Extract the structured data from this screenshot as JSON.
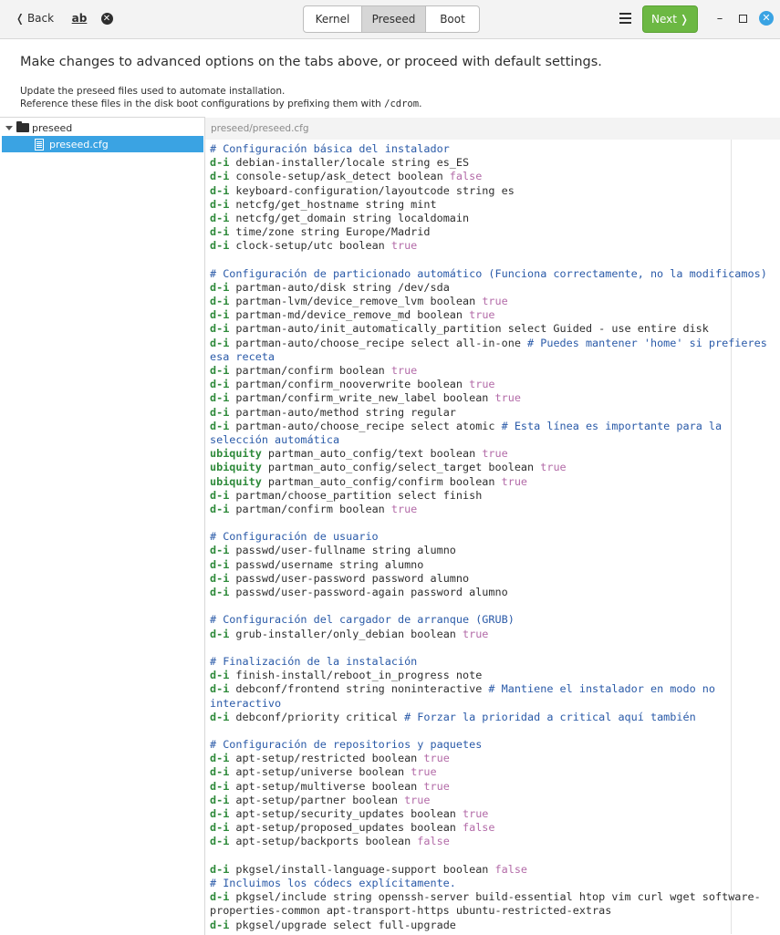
{
  "header": {
    "back_label": "Back",
    "spell_icon_text": "ab",
    "tabs": [
      "Kernel",
      "Preseed",
      "Boot"
    ],
    "active_tab": "Preseed",
    "next_label": "Next",
    "minimize_glyph": "–"
  },
  "content": {
    "heading": "Make changes to advanced options on the tabs above, or proceed with default settings.",
    "description_line1": "Update the preseed files used to automate installation.",
    "description_line2_prefix": "Reference these files in the disk boot configurations by prefixing them with ",
    "description_line2_code": "/cdrom",
    "description_line2_suffix": "."
  },
  "tree": {
    "folder_label": "preseed",
    "file_label": "preseed.cfg"
  },
  "editor": {
    "path": "preseed/preseed.cfg",
    "lines": [
      [
        [
          "cm",
          "# Configuración básica del instalador"
        ]
      ],
      [
        [
          "kw",
          "d-i"
        ],
        [
          "t",
          " debian-installer/locale string es_ES"
        ]
      ],
      [
        [
          "kw",
          "d-i"
        ],
        [
          "t",
          " console-setup/ask_detect boolean "
        ],
        [
          "bl",
          "false"
        ]
      ],
      [
        [
          "kw",
          "d-i"
        ],
        [
          "t",
          " keyboard-configuration/layoutcode string es"
        ]
      ],
      [
        [
          "kw",
          "d-i"
        ],
        [
          "t",
          " netcfg/get_hostname string mint"
        ]
      ],
      [
        [
          "kw",
          "d-i"
        ],
        [
          "t",
          " netcfg/get_domain string localdomain"
        ]
      ],
      [
        [
          "kw",
          "d-i"
        ],
        [
          "t",
          " time/zone string Europe/Madrid"
        ]
      ],
      [
        [
          "kw",
          "d-i"
        ],
        [
          "t",
          " clock-setup/utc boolean "
        ],
        [
          "bl",
          "true"
        ]
      ],
      [],
      [
        [
          "cm",
          "# Configuración de particionado automático (Funciona correctamente, no la modificamos)"
        ]
      ],
      [
        [
          "kw",
          "d-i"
        ],
        [
          "t",
          " partman-auto/disk string /dev/sda"
        ]
      ],
      [
        [
          "kw",
          "d-i"
        ],
        [
          "t",
          " partman-lvm/device_remove_lvm boolean "
        ],
        [
          "bl",
          "true"
        ]
      ],
      [
        [
          "kw",
          "d-i"
        ],
        [
          "t",
          " partman-md/device_remove_md boolean "
        ],
        [
          "bl",
          "true"
        ]
      ],
      [
        [
          "kw",
          "d-i"
        ],
        [
          "t",
          " partman-auto/init_automatically_partition select Guided - use entire disk"
        ]
      ],
      [
        [
          "kw",
          "d-i"
        ],
        [
          "t",
          " partman-auto/choose_recipe select all-in-one "
        ],
        [
          "cm",
          "# Puedes mantener 'home' si prefieres"
        ]
      ],
      [
        [
          "cm",
          "esa receta"
        ]
      ],
      [
        [
          "kw",
          "d-i"
        ],
        [
          "t",
          " partman/confirm boolean "
        ],
        [
          "bl",
          "true"
        ]
      ],
      [
        [
          "kw",
          "d-i"
        ],
        [
          "t",
          " partman/confirm_nooverwrite boolean "
        ],
        [
          "bl",
          "true"
        ]
      ],
      [
        [
          "kw",
          "d-i"
        ],
        [
          "t",
          " partman/confirm_write_new_label boolean "
        ],
        [
          "bl",
          "true"
        ]
      ],
      [
        [
          "kw",
          "d-i"
        ],
        [
          "t",
          " partman-auto/method string regular"
        ]
      ],
      [
        [
          "kw",
          "d-i"
        ],
        [
          "t",
          " partman-auto/choose_recipe select atomic "
        ],
        [
          "cm",
          "# Esta línea es importante para la"
        ]
      ],
      [
        [
          "cm",
          "selección automática"
        ]
      ],
      [
        [
          "kw",
          "ubiquity"
        ],
        [
          "t",
          " partman_auto_config/text boolean "
        ],
        [
          "bl",
          "true"
        ]
      ],
      [
        [
          "kw",
          "ubiquity"
        ],
        [
          "t",
          " partman_auto_config/select_target boolean "
        ],
        [
          "bl",
          "true"
        ]
      ],
      [
        [
          "kw",
          "ubiquity"
        ],
        [
          "t",
          " partman_auto_config/confirm boolean "
        ],
        [
          "bl",
          "true"
        ]
      ],
      [
        [
          "kw",
          "d-i"
        ],
        [
          "t",
          " partman/choose_partition select finish"
        ]
      ],
      [
        [
          "kw",
          "d-i"
        ],
        [
          "t",
          " partman/confirm boolean "
        ],
        [
          "bl",
          "true"
        ]
      ],
      [],
      [
        [
          "cm",
          "# Configuración de usuario"
        ]
      ],
      [
        [
          "kw",
          "d-i"
        ],
        [
          "t",
          " passwd/user-fullname string alumno"
        ]
      ],
      [
        [
          "kw",
          "d-i"
        ],
        [
          "t",
          " passwd/username string alumno"
        ]
      ],
      [
        [
          "kw",
          "d-i"
        ],
        [
          "t",
          " passwd/user-password password alumno"
        ]
      ],
      [
        [
          "kw",
          "d-i"
        ],
        [
          "t",
          " passwd/user-password-again password alumno"
        ]
      ],
      [],
      [
        [
          "cm",
          "# Configuración del cargador de arranque (GRUB)"
        ]
      ],
      [
        [
          "kw",
          "d-i"
        ],
        [
          "t",
          " grub-installer/only_debian boolean "
        ],
        [
          "bl",
          "true"
        ]
      ],
      [],
      [
        [
          "cm",
          "# Finalización de la instalación"
        ]
      ],
      [
        [
          "kw",
          "d-i"
        ],
        [
          "t",
          " finish-install/reboot_in_progress note"
        ]
      ],
      [
        [
          "kw",
          "d-i"
        ],
        [
          "t",
          " debconf/frontend string noninteractive "
        ],
        [
          "cm",
          "# Mantiene el instalador en modo no"
        ]
      ],
      [
        [
          "cm",
          "interactivo"
        ]
      ],
      [
        [
          "kw",
          "d-i"
        ],
        [
          "t",
          " debconf/priority critical "
        ],
        [
          "cm",
          "# Forzar la prioridad a critical aquí también"
        ]
      ],
      [],
      [
        [
          "cm",
          "# Configuración de repositorios y paquetes"
        ]
      ],
      [
        [
          "kw",
          "d-i"
        ],
        [
          "t",
          " apt-setup/restricted boolean "
        ],
        [
          "bl",
          "true"
        ]
      ],
      [
        [
          "kw",
          "d-i"
        ],
        [
          "t",
          " apt-setup/universe boolean "
        ],
        [
          "bl",
          "true"
        ]
      ],
      [
        [
          "kw",
          "d-i"
        ],
        [
          "t",
          " apt-setup/multiverse boolean "
        ],
        [
          "bl",
          "true"
        ]
      ],
      [
        [
          "kw",
          "d-i"
        ],
        [
          "t",
          " apt-setup/partner boolean "
        ],
        [
          "bl",
          "true"
        ]
      ],
      [
        [
          "kw",
          "d-i"
        ],
        [
          "t",
          " apt-setup/security_updates boolean "
        ],
        [
          "bl",
          "true"
        ]
      ],
      [
        [
          "kw",
          "d-i"
        ],
        [
          "t",
          " apt-setup/proposed_updates boolean "
        ],
        [
          "bl",
          "false"
        ]
      ],
      [
        [
          "kw",
          "d-i"
        ],
        [
          "t",
          " apt-setup/backports boolean "
        ],
        [
          "bl",
          "false"
        ]
      ],
      [],
      [
        [
          "kw",
          "d-i"
        ],
        [
          "t",
          " pkgsel/install-language-support boolean "
        ],
        [
          "bl",
          "false"
        ]
      ],
      [
        [
          "cm",
          "# Incluimos los códecs explícitamente."
        ]
      ],
      [
        [
          "kw",
          "d-i"
        ],
        [
          "t",
          " pkgsel/include string openssh-server build-essential htop vim curl wget software-"
        ]
      ],
      [
        [
          "t",
          "properties-common apt-transport-https ubuntu-restricted-extras"
        ]
      ],
      [
        [
          "kw",
          "d-i"
        ],
        [
          "t",
          " pkgsel/upgrade select full-upgrade"
        ]
      ]
    ]
  },
  "colors": {
    "accent_blue": "#3aa3e3",
    "next_green": "#6cb843",
    "keyword_green": "#2f8a3b",
    "comment_blue": "#2a5aa8",
    "boolean_pink": "#b36ba8"
  }
}
